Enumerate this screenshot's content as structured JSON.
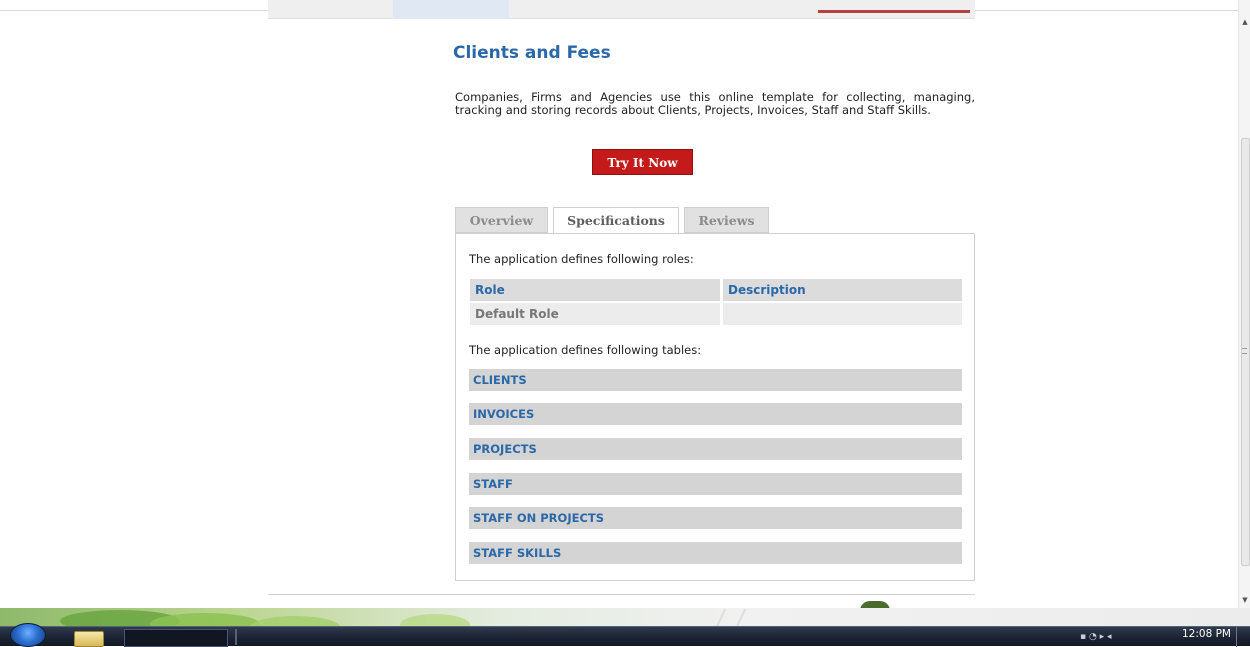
{
  "page": {
    "title": "Clients and Fees",
    "description": "Companies, Firms and Agencies use this online template for collecting, managing, tracking and storing records about Clients, Projects, Invoices, Staff and Staff Skills.",
    "cta_label": "Try It Now"
  },
  "tabs": [
    {
      "label": "Overview",
      "active": false
    },
    {
      "label": "Specifications",
      "active": true
    },
    {
      "label": "Reviews",
      "active": false
    }
  ],
  "spec": {
    "roles_intro": "The application defines following roles:",
    "roles_headers": [
      "Role",
      "Description"
    ],
    "roles_rows": [
      [
        "Default Role",
        ""
      ]
    ],
    "tables_intro": "The application defines following tables:",
    "tables": [
      "CLIENTS",
      "INVOICES",
      "PROJECTS",
      "STAFF",
      "STAFF ON PROJECTS",
      "STAFF SKILLS"
    ]
  },
  "taskbar": {
    "clock": "12:08 PM"
  },
  "colors": {
    "accent": "#2a68a8",
    "cta": "#c41a1a"
  }
}
